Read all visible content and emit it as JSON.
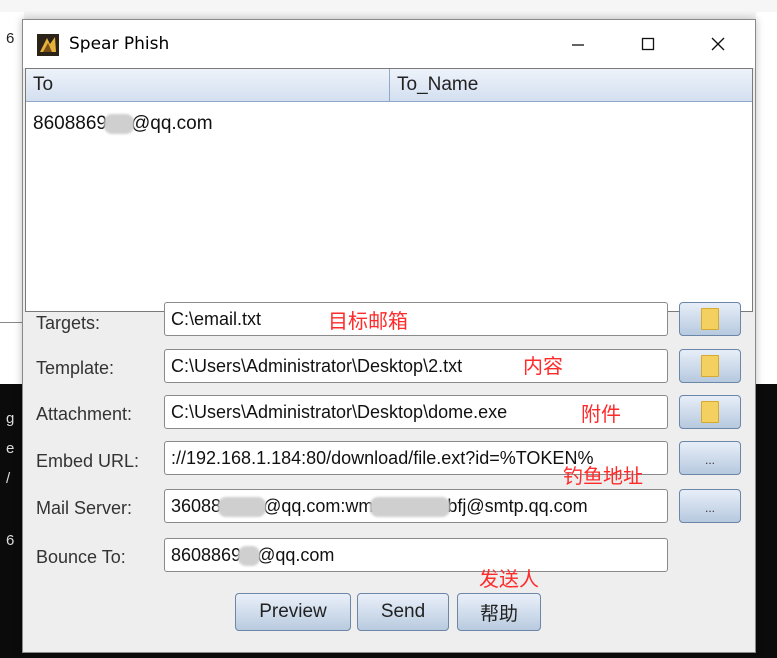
{
  "window": {
    "title": "Spear Phish"
  },
  "table": {
    "headers": [
      "To",
      "To_Name"
    ],
    "rows": [
      {
        "to_pre": "8608869",
        "to_post": "@qq.com",
        "to_name": ""
      }
    ]
  },
  "form": {
    "targets": {
      "label": "Targets:",
      "value": "C:\\email.txt"
    },
    "template": {
      "label": "Template:",
      "value": "C:\\Users\\Administrator\\Desktop\\2.txt"
    },
    "attachment": {
      "label": "Attachment:",
      "value": "C:\\Users\\Administrator\\Desktop\\dome.exe"
    },
    "embed_url": {
      "label": "Embed URL:",
      "value": "://192.168.1.184:80/download/file.ext?id=%TOKEN%"
    },
    "mail_server": {
      "label": "Mail Server:",
      "value_a": "36088",
      "value_b": "@qq.com:wm",
      "value_c": "bfj@smtp.qq.com"
    },
    "bounce_to": {
      "label": "Bounce To:",
      "value_pre": "8608869",
      "value_post": "@qq.com"
    },
    "browse_label": "..."
  },
  "annotations": {
    "targets": "目标邮箱",
    "template": "内容",
    "attachment": "附件",
    "embed_url": "钓鱼地址",
    "sender": "发送人"
  },
  "buttons": {
    "preview": "Preview",
    "send": "Send",
    "help": "帮助"
  },
  "background": {
    "glyphs": [
      "6",
      "g",
      "e",
      "/",
      "6"
    ]
  },
  "colors": {
    "annotation": "#ff2a2a",
    "header": "#d3dff0",
    "button": "#b9cbe0"
  }
}
